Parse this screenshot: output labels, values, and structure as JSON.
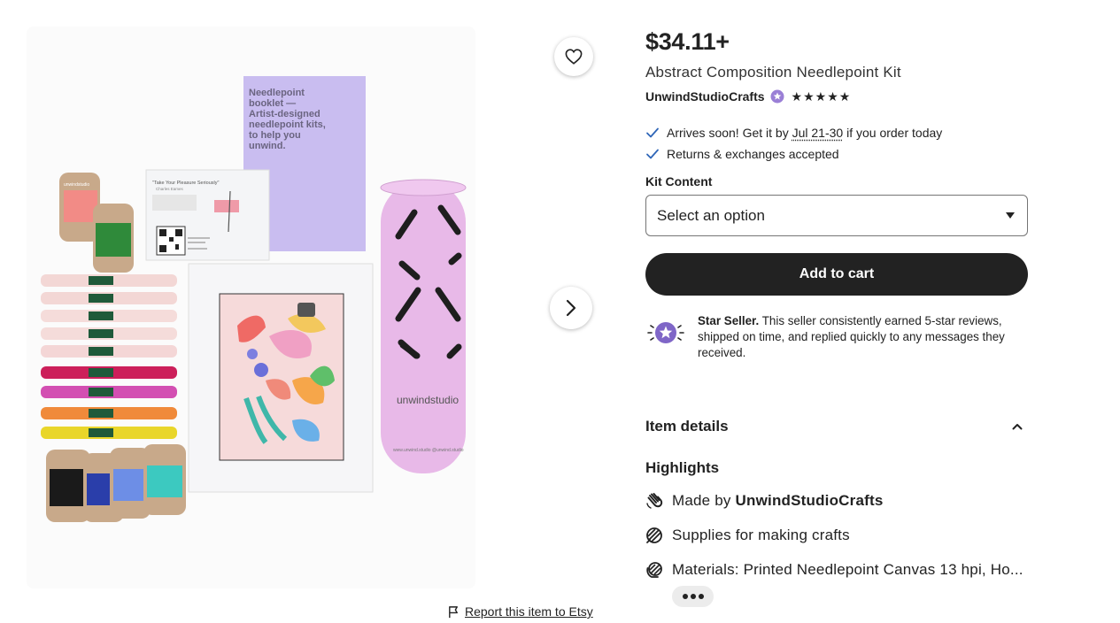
{
  "listing": {
    "price": "$34.11+",
    "title": "Abstract Composition Needlepoint Kit",
    "shop_name": "UnwindStudioCrafts",
    "rating_stars": 5,
    "star_glyph": "★"
  },
  "image": {
    "booklet_text": [
      "Needlepoint",
      "booklet —",
      "Artist-designed",
      "needlepoint kits,",
      "to help you",
      "unwind."
    ],
    "card_title": "\"Take Your Pleasure Seriously\"",
    "card_subtitle": "Charles Eames",
    "tube_brand": "unwindstudio",
    "tube_small": "www.unwind.studio   @unwind.studio",
    "bobbin_label": "unwindstudio"
  },
  "shipping": {
    "arrives_prefix": "Arrives soon! Get it by ",
    "arrives_dates": "Jul 21-30",
    "arrives_suffix": " if you order today",
    "returns": "Returns & exchanges accepted"
  },
  "options": {
    "label": "Kit Content",
    "placeholder": "Select an option"
  },
  "actions": {
    "add_to_cart": "Add to cart",
    "report": "Report this item to Etsy"
  },
  "star_seller": {
    "title": "Star Seller.",
    "description": " This seller consistently earned 5-star reviews, shipped on time, and replied quickly to any messages they received."
  },
  "details": {
    "header": "Item details",
    "highlights_title": "Highlights",
    "made_by_prefix": "Made by ",
    "made_by_shop": "UnwindStudioCrafts",
    "supplies": "Supplies for making crafts",
    "materials": "Materials: Printed Needlepoint Canvas 13 hpi, Ho..."
  },
  "colors": {
    "accent_purple": "#7f66c7",
    "button_dark": "#222222",
    "check_blue": "#2f66b8"
  }
}
